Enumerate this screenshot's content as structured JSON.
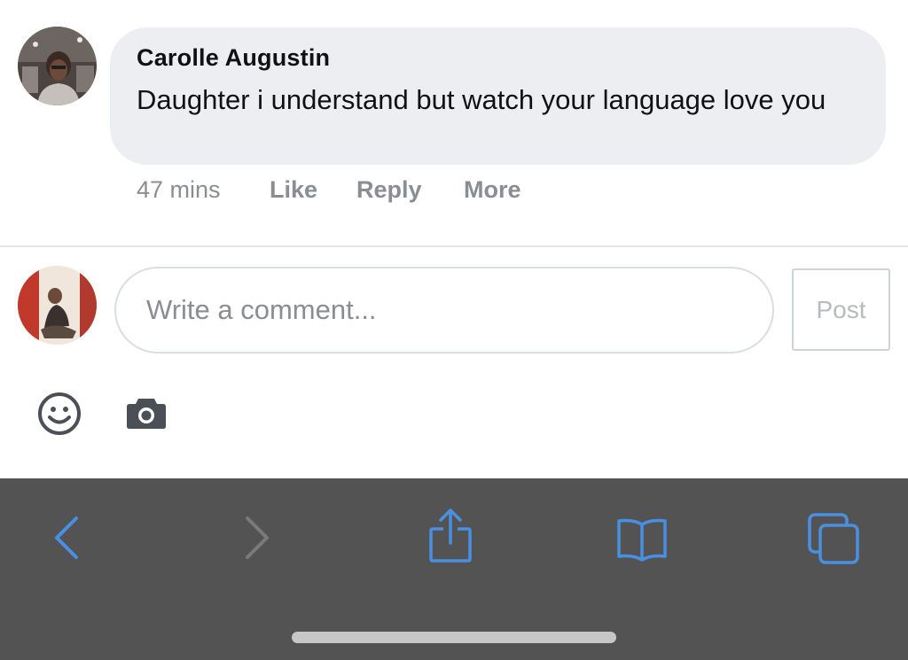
{
  "comment": {
    "author": "Carolle Augustin",
    "text": "Daughter i understand but watch your language love you",
    "time": "47 mins",
    "actions": {
      "like": "Like",
      "reply": "Reply",
      "more": "More"
    }
  },
  "composer": {
    "placeholder": "Write a comment...",
    "post_label": "Post",
    "icons": [
      "smiley-icon",
      "camera-icon"
    ]
  },
  "browser_toolbar": {
    "icons": [
      "back-chevron-icon",
      "forward-chevron-icon",
      "share-icon",
      "bookmarks-book-icon",
      "tabs-icon"
    ],
    "colors": {
      "background": "#535353",
      "active_icon": "#4a90e2",
      "disabled_icon": "#7a7a7a"
    }
  }
}
